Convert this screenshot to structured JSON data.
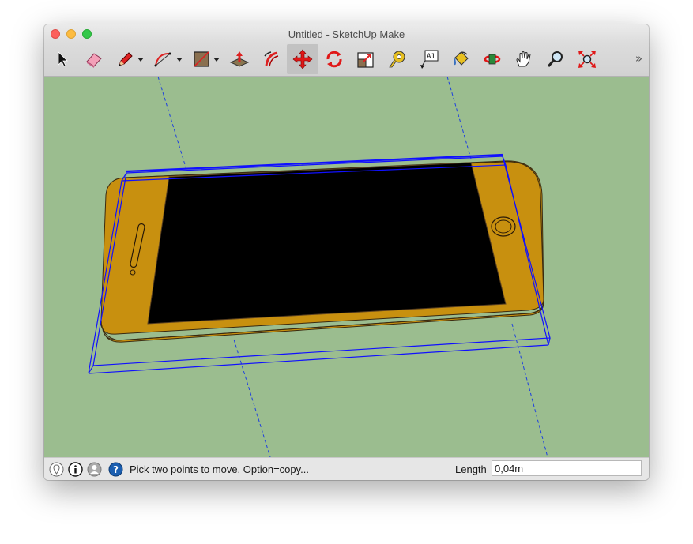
{
  "window": {
    "title": "Untitled - SketchUp Make"
  },
  "toolbar": {
    "tools": [
      {
        "name": "select-tool",
        "icon": "arrow-icon"
      },
      {
        "name": "eraser-tool",
        "icon": "eraser-icon"
      },
      {
        "name": "pencil-tool",
        "icon": "pencil-icon",
        "dropdown": true
      },
      {
        "name": "arc-tool",
        "icon": "arc-icon",
        "dropdown": true
      },
      {
        "name": "rectangle-tool",
        "icon": "rectangle-icon",
        "dropdown": true
      },
      {
        "name": "push-pull-tool",
        "icon": "push-pull-icon"
      },
      {
        "name": "follow-me-tool",
        "icon": "follow-me-icon"
      },
      {
        "name": "move-tool",
        "icon": "move-icon",
        "active": true
      },
      {
        "name": "rotate-tool",
        "icon": "rotate-icon"
      },
      {
        "name": "scale-tool",
        "icon": "scale-icon"
      },
      {
        "name": "tape-measure-tool",
        "icon": "tape-measure-icon"
      },
      {
        "name": "text-tool",
        "icon": "text-icon",
        "glyph": "A1"
      },
      {
        "name": "paint-bucket-tool",
        "icon": "paint-bucket-icon"
      },
      {
        "name": "orbit-tool",
        "icon": "orbit-icon"
      },
      {
        "name": "pan-tool",
        "icon": "hand-icon"
      },
      {
        "name": "zoom-tool",
        "icon": "magnifier-icon"
      },
      {
        "name": "zoom-extents-tool",
        "icon": "zoom-extents-icon"
      }
    ],
    "overflow_glyph": "»"
  },
  "statusbar": {
    "message": "Pick two points to move.  Option=copy...",
    "length_label": "Length",
    "length_value": "0,04m"
  },
  "colors": {
    "background": "#9bbd8f",
    "phone_body": "#c8900f",
    "screen": "#000000",
    "selection": "#0000ff"
  }
}
